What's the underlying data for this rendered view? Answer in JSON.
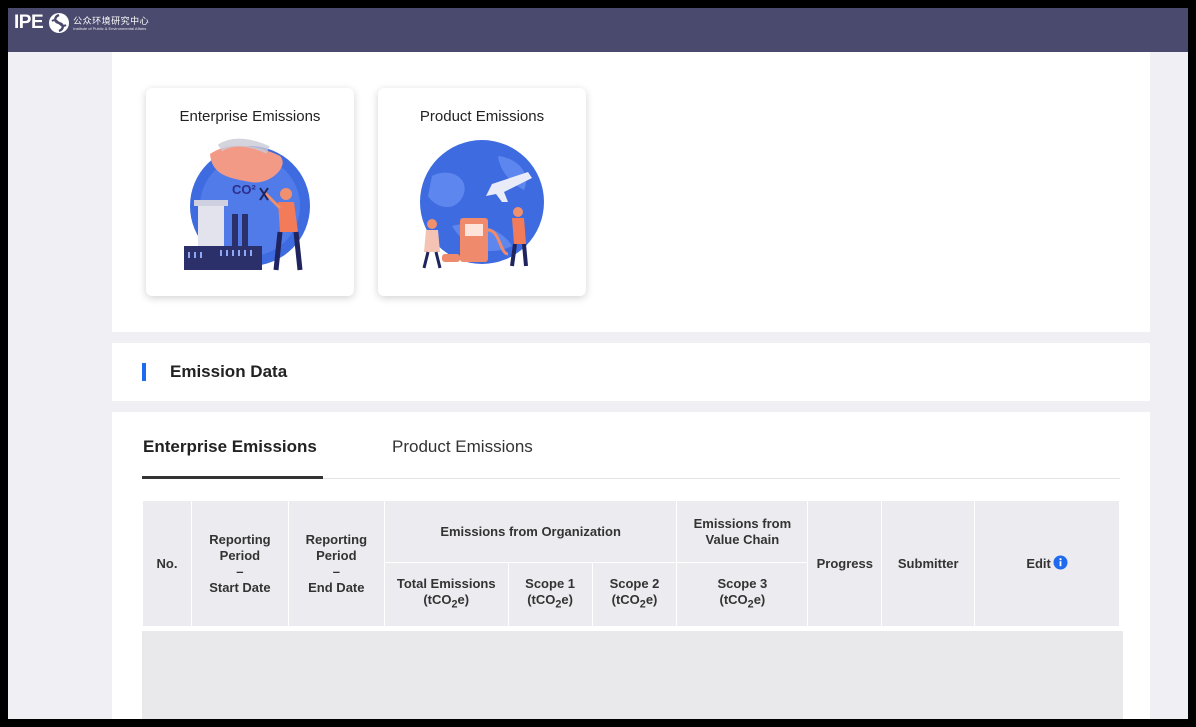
{
  "header": {
    "logo_ipe": "IPE",
    "logo_cn": "公众环境研究中心",
    "logo_en": "Institute of Public & Environmental Affairs"
  },
  "cards": [
    {
      "title": "Enterprise Emissions",
      "icon": "factory-emissions-illustration"
    },
    {
      "title": "Product Emissions",
      "icon": "globe-transport-illustration"
    }
  ],
  "section": {
    "title": "Emission Data"
  },
  "tabs": [
    {
      "label": "Enterprise Emissions",
      "active": true
    },
    {
      "label": "Product Emissions",
      "active": false
    }
  ],
  "table": {
    "col_no": "No.",
    "col_start": {
      "line1": "Reporting",
      "line2": "Period",
      "dash": "–",
      "line3": "Start Date"
    },
    "col_end": {
      "line1": "Reporting",
      "line2": "Period",
      "dash": "–",
      "line3": "End Date"
    },
    "group_org": "Emissions from Organization",
    "group_chain": {
      "line1": "Emissions from",
      "line2": "Value Chain"
    },
    "sub_total": {
      "label": "Total Emissions"
    },
    "sub_scope1": {
      "label": "Scope 1"
    },
    "sub_scope2": {
      "label": "Scope 2"
    },
    "sub_scope3": {
      "label": "Scope 3"
    },
    "unit": {
      "pre": "(tCO",
      "sub": "2",
      "post": "e)"
    },
    "col_progress": "Progress",
    "col_submitter": "Submitter",
    "col_edit": "Edit",
    "rows": []
  },
  "colors": {
    "header_bg": "#4a4a6e",
    "accent": "#1e6bf0",
    "table_header_bg": "#ececf0",
    "info_icon": "#1e6bf0"
  }
}
